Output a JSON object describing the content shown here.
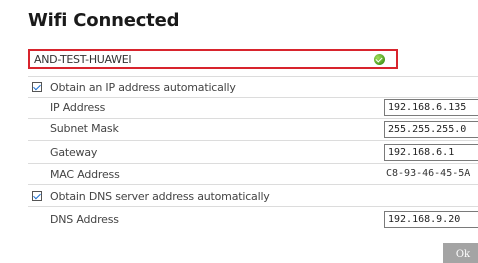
{
  "title": "Wifi Connected",
  "network": {
    "name": "AND-TEST-HUAWEI",
    "status_color": "#5cb82a"
  },
  "ip_auto": {
    "label": "Obtain an IP address automatically",
    "checked": true
  },
  "fields": {
    "ip_address": {
      "label": "IP Address",
      "value": "192.168.6.135"
    },
    "subnet_mask": {
      "label": "Subnet Mask",
      "value": "255.255.255.0"
    },
    "gateway": {
      "label": "Gateway",
      "value": "192.168.6.1"
    },
    "mac_address": {
      "label": "MAC Address",
      "value": "C8-93-46-45-5A"
    }
  },
  "dns_auto": {
    "label": "Obtain DNS server address automatically",
    "checked": true
  },
  "dns": {
    "label": "DNS Address",
    "value": "192.168.9.20"
  },
  "ok_button": {
    "label": "Ok"
  }
}
